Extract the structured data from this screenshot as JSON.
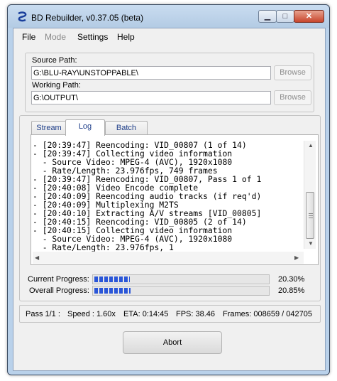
{
  "window": {
    "title": "BD Rebuilder, v0.37.05 (beta)"
  },
  "menu": {
    "file": "File",
    "mode": "Mode",
    "settings": "Settings",
    "help": "Help"
  },
  "paths": {
    "source_label": "Source Path:",
    "source_value": "G:\\BLU-RAY\\UNSTOPPABLE\\",
    "working_label": "Working Path:",
    "working_value": "G:\\OUTPUT\\",
    "browse_label": "Browse"
  },
  "tabs": {
    "stream": "Stream",
    "log": "Log",
    "batch": "Batch"
  },
  "log": {
    "lines": [
      "- [20:39:47] Reencoding: VID_00807 (1 of 14)",
      "- [20:39:47] Collecting video information",
      "  - Source Video: MPEG-4 (AVC), 1920x1080",
      "  - Rate/Length: 23.976fps, 749 frames",
      "- [20:39:47] Reencoding: VID_00807, Pass 1 of 1",
      "- [20:40:08] Video Encode complete",
      "- [20:40:09] Reencoding audio tracks (if req'd)",
      "- [20:40:09] Multiplexing M2TS",
      "- [20:40:10] Extracting A/V streams [VID_00805]",
      "- [20:40:15] Reencoding: VID_00805 (2 of 14)",
      "- [20:40:15] Collecting video information",
      "  - Source Video: MPEG-4 (AVC), 1920x1080",
      "  - Rate/Length: 23.976fps, 1"
    ]
  },
  "progress": {
    "current_label": "Current Progress:",
    "current_value": "20.30%",
    "current_fraction": 0.203,
    "overall_label": "Overall Progress:",
    "overall_value": "20.85%",
    "overall_fraction": 0.2085,
    "fill_color": "#2a56d8"
  },
  "status": {
    "pass": "Pass 1/1 :",
    "speed": "Speed : 1.60x",
    "eta": "ETA:  0:14:45",
    "fps": "FPS:  38.46",
    "frames": "Frames: 008659 / 042705"
  },
  "abort_label": "Abort",
  "icons": {
    "app": "bd-rebuilder-icon",
    "minimize": "minimize-icon",
    "maximize": "maximize-icon",
    "close": "close-icon"
  }
}
